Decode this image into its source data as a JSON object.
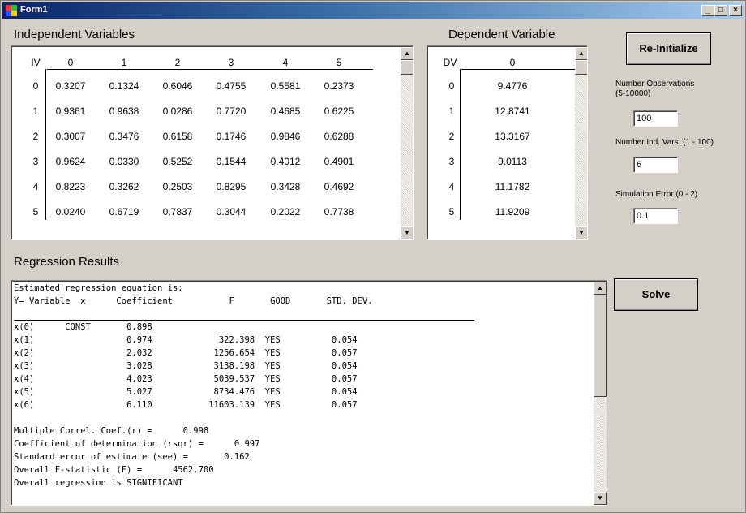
{
  "window": {
    "title": "Form1",
    "minimize": "_",
    "maximize": "□",
    "close": "×"
  },
  "independent": {
    "label": "Independent Variables",
    "corner": "IV",
    "columns": [
      "0",
      "1",
      "2",
      "3",
      "4",
      "5"
    ],
    "rows": [
      {
        "idx": "0",
        "values": [
          "0.3207",
          "0.1324",
          "0.6046",
          "0.4755",
          "0.5581",
          "0.2373"
        ]
      },
      {
        "idx": "1",
        "values": [
          "0.9361",
          "0.9638",
          "0.0286",
          "0.7720",
          "0.4685",
          "0.6225"
        ]
      },
      {
        "idx": "2",
        "values": [
          "0.3007",
          "0.3476",
          "0.6158",
          "0.1746",
          "0.9846",
          "0.6288"
        ]
      },
      {
        "idx": "3",
        "values": [
          "0.9624",
          "0.0330",
          "0.5252",
          "0.1544",
          "0.4012",
          "0.4901"
        ]
      },
      {
        "idx": "4",
        "values": [
          "0.8223",
          "0.3262",
          "0.2503",
          "0.8295",
          "0.3428",
          "0.4692"
        ]
      },
      {
        "idx": "5",
        "values": [
          "0.0240",
          "0.6719",
          "0.7837",
          "0.3044",
          "0.2022",
          "0.7738"
        ]
      }
    ]
  },
  "dependent": {
    "label": "Dependent Variable",
    "corner": "DV",
    "columns": [
      "0"
    ],
    "rows": [
      {
        "idx": "0",
        "values": [
          "9.4776"
        ]
      },
      {
        "idx": "1",
        "values": [
          "12.8741"
        ]
      },
      {
        "idx": "2",
        "values": [
          "13.3167"
        ]
      },
      {
        "idx": "3",
        "values": [
          "9.0113"
        ]
      },
      {
        "idx": "4",
        "values": [
          "11.1782"
        ]
      },
      {
        "idx": "5",
        "values": [
          "11.9209"
        ]
      }
    ]
  },
  "controls": {
    "reinit_label": "Re-Initialize",
    "solve_label": "Solve",
    "num_obs_label_1": "Number Observations",
    "num_obs_label_2": "(5-10000)",
    "num_obs_value": "100",
    "num_vars_label": "Number Ind. Vars. (1 - 100)",
    "num_vars_value": "6",
    "sim_error_label": "Simulation Error (0 - 2)",
    "sim_error_value": "0.1"
  },
  "regression": {
    "label": "Regression Results",
    "lines": [
      "Estimated regression equation is:",
      "Y= Variable  x      Coefficient           F       GOOD       STD. DEV.",
      "",
      "x(0)      CONST       0.898",
      "x(1)                  0.974             322.398  YES          0.054",
      "x(2)                  2.032            1256.654  YES          0.057",
      "x(3)                  3.028            3138.198  YES          0.054",
      "x(4)                  4.023            5039.537  YES          0.057",
      "x(5)                  5.027            8734.476  YES          0.054",
      "x(6)                  6.110           11603.139  YES          0.057",
      "",
      "Multiple Correl. Coef.(r) =      0.998",
      "Coefficient of determination (rsqr) =      0.997",
      "Standard error of estimate (see) =       0.162",
      "Overall F-statistic (F) =      4562.700",
      "Overall regression is SIGNIFICANT"
    ]
  }
}
